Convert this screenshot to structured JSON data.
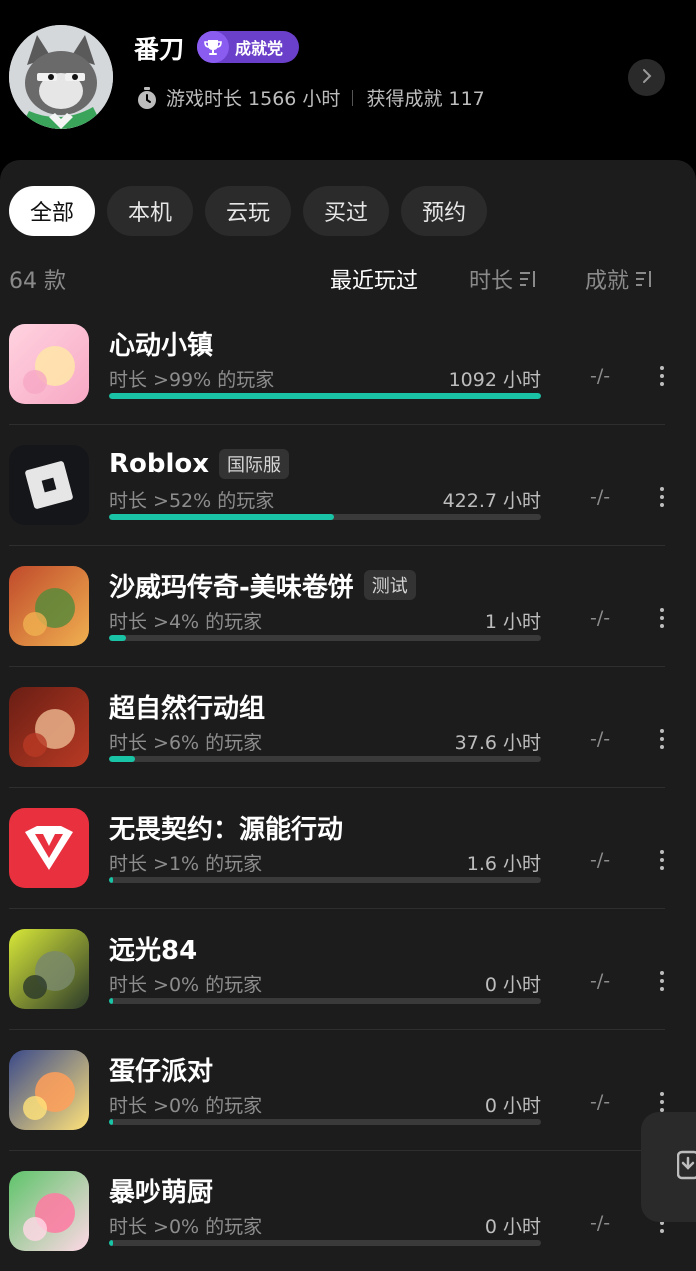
{
  "profile": {
    "name": "番刀",
    "badge": "成就党",
    "playtime": "游戏时长 1566 小时",
    "achievements": "获得成就 117"
  },
  "filters": [
    {
      "label": "全部",
      "active": true
    },
    {
      "label": "本机",
      "active": false
    },
    {
      "label": "云玩",
      "active": false
    },
    {
      "label": "买过",
      "active": false
    },
    {
      "label": "预约",
      "active": false
    }
  ],
  "list_header": {
    "count": "64 款",
    "sort_recent": "最近玩过",
    "sort_duration": "时长",
    "sort_achievement": "成就"
  },
  "games": [
    {
      "name": "心动小镇",
      "tag": "",
      "percentile": "时长 >99% 的玩家",
      "hours": "1092 小时",
      "progress": 1.0,
      "achievement": "-/-",
      "icon": "heartbeat-town-icon",
      "colors": [
        "#ffd3e0",
        "#f7a8c4",
        "#ffe6a8"
      ]
    },
    {
      "name": "Roblox",
      "tag": "国际服",
      "percentile": "时长 >52% 的玩家",
      "hours": "422.7 小时",
      "progress": 0.52,
      "achievement": "-/-",
      "icon": "roblox-icon",
      "colors": [
        "#0e0f12",
        "#2a2c30",
        "#e8e8e8"
      ]
    },
    {
      "name": "沙威玛传奇-美味卷饼",
      "tag": "测试",
      "percentile": "时长 >4% 的玩家",
      "hours": "1 小时",
      "progress": 0.04,
      "achievement": "-/-",
      "icon": "shawarma-legend-icon",
      "colors": [
        "#c04a2b",
        "#f0b050",
        "#5a8a3a"
      ]
    },
    {
      "name": "超自然行动组",
      "tag": "",
      "percentile": "时长 >6% 的玩家",
      "hours": "37.6 小时",
      "progress": 0.06,
      "achievement": "-/-",
      "icon": "supernatural-squad-icon",
      "colors": [
        "#6a1e14",
        "#b83a24",
        "#e8b08a"
      ]
    },
    {
      "name": "无畏契约：源能行动",
      "tag": "",
      "percentile": "时长 >1% 的玩家",
      "hours": "1.6 小时",
      "progress": 0.01,
      "achievement": "-/-",
      "icon": "valorant-icon",
      "colors": [
        "#e8303e",
        "#ffffff",
        "#ff6f7a"
      ]
    },
    {
      "name": "远光84",
      "tag": "",
      "percentile": "时长 >0% 的玩家",
      "hours": "0 小时",
      "progress": 0.0,
      "achievement": "-/-",
      "icon": "farlight84-icon",
      "colors": [
        "#d8e838",
        "#2c3a2a",
        "#7a8a6a"
      ]
    },
    {
      "name": "蛋仔派对",
      "tag": "",
      "percentile": "时长 >0% 的玩家",
      "hours": "0 小时",
      "progress": 0.0,
      "achievement": "-/-",
      "icon": "eggy-party-icon",
      "colors": [
        "#3a4a8a",
        "#ffe27a",
        "#ff9f5a"
      ]
    },
    {
      "name": "暴吵萌厨",
      "tag": "",
      "percentile": "时长 >0% 的玩家",
      "hours": "0 小时",
      "progress": 0.0,
      "achievement": "-/-",
      "icon": "cooking-chaos-icon",
      "colors": [
        "#5ec46a",
        "#ffd8e6",
        "#ff7aa2"
      ]
    }
  ],
  "accent_color": "#18c4a5",
  "badge_color": "#6a3fc9"
}
